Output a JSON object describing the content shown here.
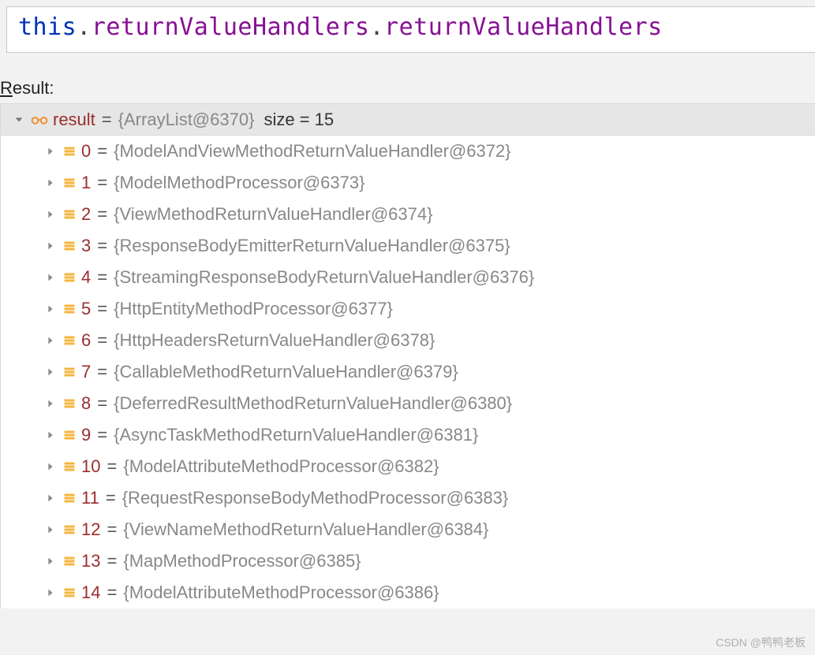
{
  "expression": {
    "keyword": "this",
    "dot1": ".",
    "field1": "returnValueHandlers",
    "dot2": ".",
    "field2": "returnValueHandlers"
  },
  "result_label_prefix": "R",
  "result_label_rest": "esult:",
  "header": {
    "name": "result",
    "eq": "=",
    "type": "{ArrayList@6370}",
    "size_label": "size = 15"
  },
  "items": [
    {
      "index": "0",
      "value": "{ModelAndViewMethodReturnValueHandler@6372}"
    },
    {
      "index": "1",
      "value": "{ModelMethodProcessor@6373}"
    },
    {
      "index": "2",
      "value": "{ViewMethodReturnValueHandler@6374}"
    },
    {
      "index": "3",
      "value": "{ResponseBodyEmitterReturnValueHandler@6375}"
    },
    {
      "index": "4",
      "value": "{StreamingResponseBodyReturnValueHandler@6376}"
    },
    {
      "index": "5",
      "value": "{HttpEntityMethodProcessor@6377}"
    },
    {
      "index": "6",
      "value": "{HttpHeadersReturnValueHandler@6378}"
    },
    {
      "index": "7",
      "value": "{CallableMethodReturnValueHandler@6379}"
    },
    {
      "index": "8",
      "value": "{DeferredResultMethodReturnValueHandler@6380}"
    },
    {
      "index": "9",
      "value": "{AsyncTaskMethodReturnValueHandler@6381}"
    },
    {
      "index": "10",
      "value": "{ModelAttributeMethodProcessor@6382}"
    },
    {
      "index": "11",
      "value": "{RequestResponseBodyMethodProcessor@6383}"
    },
    {
      "index": "12",
      "value": "{ViewNameMethodReturnValueHandler@6384}"
    },
    {
      "index": "13",
      "value": "{MapMethodProcessor@6385}"
    },
    {
      "index": "14",
      "value": "{ModelAttributeMethodProcessor@6386}"
    }
  ],
  "watermark": "CSDN @鸭鸭老板"
}
